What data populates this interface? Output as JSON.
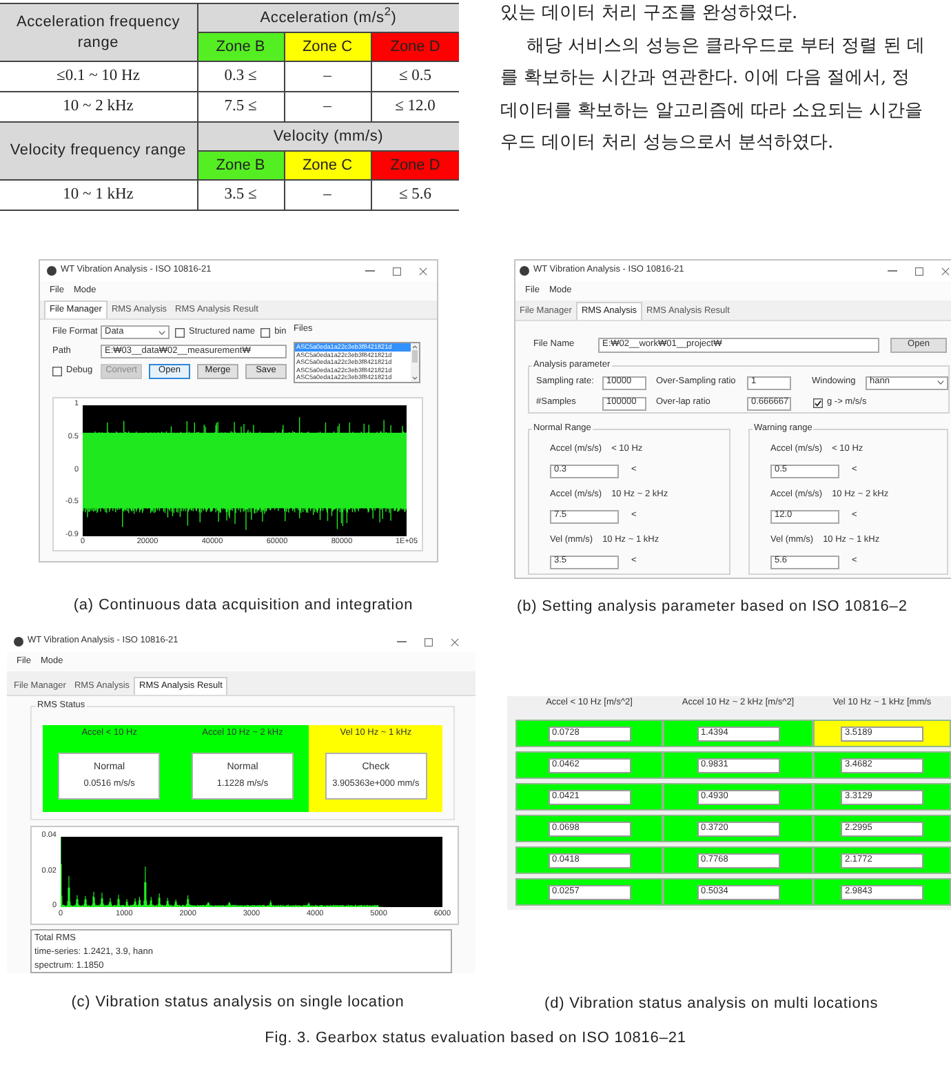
{
  "table": {
    "sections": [
      {
        "range_header": "Acceleration frequency range",
        "quantity": "Acceleration (m/s$^{2}$)",
        "zones": [
          {
            "label": "Zone B",
            "color": "#55ee22"
          },
          {
            "label": "Zone C",
            "color": "#ffff00"
          },
          {
            "label": "Zone D",
            "color": "#ff0000"
          }
        ],
        "rows": [
          {
            "range": "≤0.1 ~ 10 Hz",
            "cells": [
              "0.3 ≤",
              "–",
              "≤ 0.5"
            ]
          },
          {
            "range": "10 ~ 2 kHz",
            "cells": [
              "7.5 ≤",
              "–",
              "≤ 12.0"
            ]
          }
        ]
      },
      {
        "range_header": "Velocity frequency range",
        "quantity": "Velocity (mm/s)",
        "zones": [
          {
            "label": "Zone B",
            "color": "#55ee22"
          },
          {
            "label": "Zone C",
            "color": "#ffff00"
          },
          {
            "label": "Zone D",
            "color": "#ff0000"
          }
        ],
        "rows": [
          {
            "range": "10 ~ 1 kHz",
            "cells": [
              "3.5 ≤",
              "–",
              "≤ 5.6"
            ]
          }
        ]
      }
    ]
  },
  "body_text": [
    {
      "text": "있는 데이터 처리 구조를 완성하였다.",
      "indent": false
    },
    {
      "text": "해당 서비스의 성능은 클라우드로 부터 정렬 된 데",
      "indent": true
    },
    {
      "text": "를 확보하는 시간과 연관한다. 이에 다음 절에서, 정",
      "indent": false
    },
    {
      "text": "데이터를 확보하는 알고리즘에 따라 소요되는 시간을",
      "indent": false
    },
    {
      "text": "우드 데이터 처리 성능으로서 분석하였다.",
      "indent": false
    }
  ],
  "figures": [
    {
      "kind": "file_manager",
      "window": {
        "title": "WT Vibration Analysis - ISO 10816-21",
        "menu": [
          "File",
          "Mode"
        ],
        "tabs": [
          {
            "label": "File Manager",
            "selected": true
          },
          {
            "label": "RMS Analysis",
            "selected": false
          },
          {
            "label": "RMS Analysis Result",
            "selected": false
          }
        ]
      },
      "format": {
        "label": "File Format",
        "value": "Data"
      },
      "options": [
        {
          "label": "Structured name",
          "checked": false
        },
        {
          "label": "bin",
          "checked": false
        }
      ],
      "path": {
        "label": "Path",
        "value": "E:₩03__data₩02__measurement₩"
      },
      "debug": {
        "label": "Debug",
        "checked": false
      },
      "buttons": [
        {
          "label": "Convert",
          "disabled": true,
          "focused": false
        },
        {
          "label": "Open",
          "disabled": false,
          "focused": true
        },
        {
          "label": "Merge",
          "disabled": false,
          "focused": false
        },
        {
          "label": "Save",
          "disabled": false,
          "focused": false
        }
      ],
      "files": {
        "label": "Files",
        "items": [
          {
            "name": "ASC5a0eda1a22c3eb3f8421821d",
            "selected": true
          },
          {
            "name": "ASC5a0eda1a22c3eb3f8421821d",
            "selected": false
          },
          {
            "name": "ASC5a0eda1a22c3eb3f8421821d",
            "selected": false
          },
          {
            "name": "ASC5a0eda1a22c3eb3f8421821d",
            "selected": false
          },
          {
            "name": "ASC5a0eda1a22c3eb3f8421821d",
            "selected": false
          }
        ]
      },
      "plot": {
        "y_ticks": [
          "1",
          "0.5",
          "0",
          "-0.5",
          "-0.9"
        ],
        "x_ticks": [
          "0",
          "20000",
          "40000",
          "60000",
          "80000",
          "1E+05"
        ]
      },
      "caption": "(a) Continuous data acquisition and integration"
    },
    {
      "kind": "rms_analysis",
      "window": {
        "title": "WT Vibration Analysis - ISO 10816-21",
        "menu": [
          "File",
          "Mode"
        ],
        "tabs": [
          {
            "label": "File Manager",
            "selected": false
          },
          {
            "label": "RMS Analysis",
            "selected": true
          },
          {
            "label": "RMS Analysis Result",
            "selected": false
          }
        ]
      },
      "file_name": {
        "label": "File Name",
        "value": "E:₩02__work₩01__project₩",
        "button": "Open"
      },
      "parameters": {
        "title": "Analysis parameter",
        "fields": [
          {
            "kind": "input",
            "label": "Sampling rate:",
            "value": "10000"
          },
          {
            "kind": "input",
            "label": "Over-Sampling ratio",
            "value": "1"
          },
          {
            "kind": "select",
            "label": "Windowing",
            "value": "hann"
          },
          {
            "kind": "input",
            "label": "#Samples",
            "value": "100000"
          },
          {
            "kind": "input",
            "label": "Over-lap ratio",
            "value": "0.666667"
          },
          {
            "kind": "checkbox",
            "label": "g -> m/s/s",
            "checked": true
          }
        ]
      },
      "ranges": [
        {
          "title": "Normal Range",
          "items": [
            {
              "quantity": "Accel (m/s/s)",
              "band": "< 10 Hz",
              "value": "0.3",
              "sign": "<"
            },
            {
              "quantity": "Accel (m/s/s)",
              "band": "10 Hz ~ 2 kHz",
              "value": "7.5",
              "sign": "<"
            },
            {
              "quantity": "Vel (mm/s)",
              "band": "10 Hz ~ 1 kHz",
              "value": "3.5",
              "sign": "<"
            }
          ]
        },
        {
          "title": "Warning range",
          "items": [
            {
              "quantity": "Accel (m/s/s)",
              "band": "< 10 Hz",
              "value": "0.5",
              "sign": "<"
            },
            {
              "quantity": "Accel (m/s/s)",
              "band": "10 Hz ~ 2 kHz",
              "value": "12.0",
              "sign": "<"
            },
            {
              "quantity": "Vel (mm/s)",
              "band": "10 Hz ~ 1 kHz",
              "value": "5.6",
              "sign": "<"
            }
          ]
        }
      ],
      "caption": "(b) Setting analysis parameter based on ISO 10816–2"
    },
    {
      "kind": "rms_result",
      "window": {
        "title": "WT Vibration Analysis - ISO 10816-21",
        "menu": [
          "File",
          "Mode"
        ],
        "tabs": [
          {
            "label": "File Manager",
            "selected": false
          },
          {
            "label": "RMS Analysis",
            "selected": false
          },
          {
            "label": "RMS Analysis Result",
            "selected": true
          }
        ]
      },
      "status": {
        "title": "RMS Status",
        "panels": [
          {
            "title": "Accel < 10 Hz",
            "state": "Normal",
            "value": "0.0516 m/s/s",
            "color": "#00ff00"
          },
          {
            "title": "Accel 10 Hz ~ 2 kHz",
            "state": "Normal",
            "value": "1.1228 m/s/s",
            "color": "#00ff00"
          },
          {
            "title": "Vel 10 Hz ~ 1 kHz",
            "state": "Check",
            "value": "3.905363e+000 mm/s",
            "color": "#ffff00"
          }
        ]
      },
      "plot": {
        "y_ticks": [
          "0.04",
          "0.02",
          "0"
        ],
        "x_ticks": [
          "0",
          "1000",
          "2000",
          "3000",
          "4000",
          "5000",
          "6000"
        ]
      },
      "summary": [
        "Total RMS",
        "time-series: 1.2421, 3.9, hann",
        "spectrum: 1.1850"
      ],
      "caption": "(c) Vibration status analysis on single location"
    },
    {
      "kind": "multi_location",
      "columns": [
        "Accel < 10 Hz [m/s^2]",
        "Accel 10 Hz ~ 2 kHz [m/s^2]",
        "Vel 10 Hz ~ 1 kHz [mm/s"
      ],
      "rows": [
        [
          {
            "value": "0.0728",
            "color": "#00ff00"
          },
          {
            "value": "1.4394",
            "color": "#00ff00"
          },
          {
            "value": "3.5189",
            "color": "#ffff00"
          }
        ],
        [
          {
            "value": "0.0462",
            "color": "#00ff00"
          },
          {
            "value": "0.9831",
            "color": "#00ff00"
          },
          {
            "value": "3.4682",
            "color": "#00ff00"
          }
        ],
        [
          {
            "value": "0.0421",
            "color": "#00ff00"
          },
          {
            "value": "0.4930",
            "color": "#00ff00"
          },
          {
            "value": "3.3129",
            "color": "#00ff00"
          }
        ],
        [
          {
            "value": "0.0698",
            "color": "#00ff00"
          },
          {
            "value": "0.3720",
            "color": "#00ff00"
          },
          {
            "value": "2.2995",
            "color": "#00ff00"
          }
        ],
        [
          {
            "value": "0.0418",
            "color": "#00ff00"
          },
          {
            "value": "0.7768",
            "color": "#00ff00"
          },
          {
            "value": "2.1772",
            "color": "#00ff00"
          }
        ],
        [
          {
            "value": "0.0257",
            "color": "#00ff00"
          },
          {
            "value": "0.5034",
            "color": "#00ff00"
          },
          {
            "value": "2.9843",
            "color": "#00ff00"
          }
        ]
      ],
      "caption": "(d) Vibration status analysis on multi locations"
    }
  ],
  "figure_caption": "Fig. 3. Gearbox status evaluation based on ISO 10816–21"
}
